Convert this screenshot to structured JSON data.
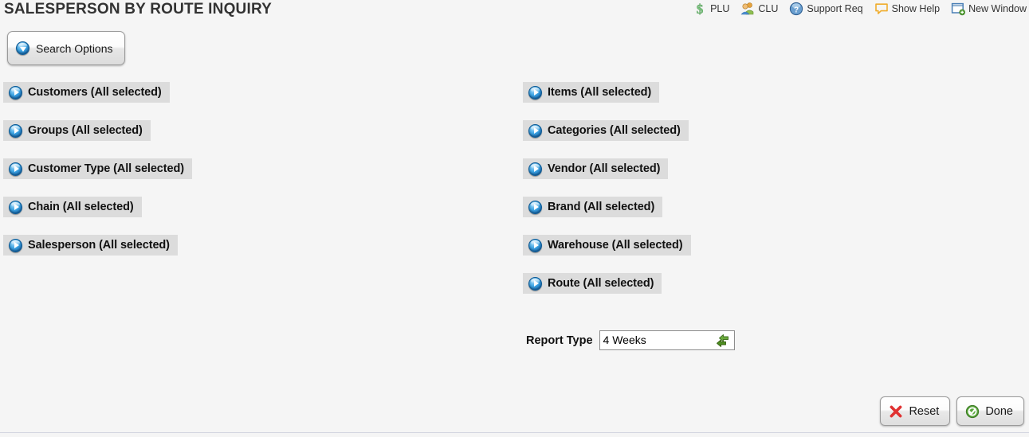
{
  "header": {
    "title": "SALESPERSON BY ROUTE INQUIRY",
    "title_color": "#333333",
    "toolbar": [
      {
        "label": "PLU",
        "icon": "dollar-sign-icon"
      },
      {
        "label": "CLU",
        "icon": "users-icon"
      },
      {
        "label": "Support Req",
        "icon": "question-mark-icon"
      },
      {
        "label": "Show Help",
        "icon": "speech-bubble-icon"
      },
      {
        "label": "New Window",
        "icon": "new-window-icon"
      }
    ]
  },
  "search_options": {
    "label": "Search Options",
    "icon": "blue-caret-down-icon"
  },
  "filters": {
    "left": [
      {
        "label": "Customers (All selected)"
      },
      {
        "label": "Groups (All selected)"
      },
      {
        "label": "Customer Type (All selected)"
      },
      {
        "label": "Chain (All selected)"
      },
      {
        "label": "Salesperson (All selected)"
      }
    ],
    "right": [
      {
        "label": "Items (All selected)"
      },
      {
        "label": "Categories (All selected)"
      },
      {
        "label": "Vendor (All selected)"
      },
      {
        "label": "Brand (All selected)"
      },
      {
        "label": "Warehouse (All selected)"
      },
      {
        "label": "Route (All selected)"
      }
    ]
  },
  "report_type": {
    "label": "Report Type",
    "value": "4 Weeks",
    "placeholder": "",
    "swap_icon": "green-swap-arrows-icon"
  },
  "footer": {
    "reset_label": "Reset",
    "done_label": "Done"
  },
  "colors": {
    "page_background": "#f5f5f5",
    "filter_row_background": "#dcdcdc",
    "accent_blue": "#3ea5e4",
    "accent_green": "#5aa63c",
    "accent_red": "#e03131",
    "divider": "#d3d5e0"
  }
}
